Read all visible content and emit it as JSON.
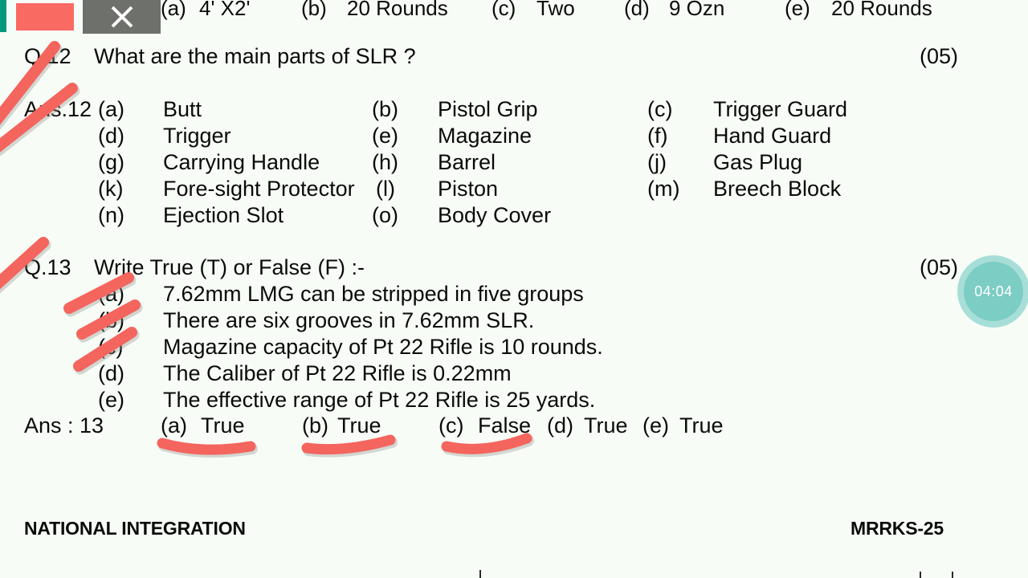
{
  "window": {
    "close_label": "close-icon",
    "accent_teal": "#00997f",
    "accent_red": "#f96a63",
    "close_bg": "#6e706b"
  },
  "timer": {
    "value": "04:04",
    "ring_color": "#a8ded8",
    "fill_color": "#7ccdc4"
  },
  "document": {
    "background": "#f7fdf6",
    "top_row": {
      "items": [
        {
          "label": "(a)",
          "text": "4' X2'"
        },
        {
          "label": "(b)",
          "text": "20 Rounds"
        },
        {
          "label": "(c)",
          "text": "Two"
        },
        {
          "label": "(d)",
          "text": "9 Ozn"
        },
        {
          "label": "(e)",
          "text": "20 Rounds"
        }
      ]
    },
    "question_12": {
      "number": "Q.12",
      "text": "What are the main parts of SLR ?",
      "marks": "(05)",
      "answer_prefix": "Ans.12",
      "rows": [
        [
          {
            "label": "(a)",
            "text": "Butt"
          },
          {
            "label": "(b)",
            "text": "Pistol Grip"
          },
          {
            "label": "(c)",
            "text": "Trigger Guard"
          }
        ],
        [
          {
            "label": "(d)",
            "text": "Trigger"
          },
          {
            "label": "(e)",
            "text": "Magazine"
          },
          {
            "label": "(f)",
            "text": "Hand Guard"
          }
        ],
        [
          {
            "label": "(g)",
            "text": "Carrying Handle"
          },
          {
            "label": "(h)",
            "text": "Barrel"
          },
          {
            "label": "(j)",
            "text": "Gas Plug"
          }
        ],
        [
          {
            "label": "(k)",
            "text": "Fore-sight Protector"
          },
          {
            "label": "(l)",
            "text": "Piston"
          },
          {
            "label": "(m)",
            "text": "Breech Block"
          }
        ],
        [
          {
            "label": "(n)",
            "text": "Ejection Slot"
          },
          {
            "label": "(o)",
            "text": "Body Cover"
          },
          {
            "label": "",
            "text": ""
          }
        ]
      ]
    },
    "question_13": {
      "number": "Q.13",
      "text": "Write True (T) or False (F) :-",
      "marks": "(05)",
      "statements": [
        {
          "label": "(a)",
          "text": "7.62mm LMG can be stripped in five groups"
        },
        {
          "label": "(b)",
          "text": "There are six grooves in 7.62mm SLR."
        },
        {
          "label": "(c)",
          "text": "Magazine capacity of Pt 22 Rifle is 10 rounds."
        },
        {
          "label": "(d)",
          "text": "The Caliber of Pt 22 Rifle is 0.22mm"
        },
        {
          "label": "(e)",
          "text": "The effective range of Pt 22 Rifle is 25 yards."
        }
      ],
      "answer_label": "Ans : 13",
      "answers": [
        {
          "label": "(a)",
          "value": "True"
        },
        {
          "label": "(b)",
          "value": "True"
        },
        {
          "label": "(c)",
          "value": "False"
        },
        {
          "label": "(d)",
          "value": "True"
        },
        {
          "label": "(e)",
          "value": "True"
        }
      ]
    },
    "footer": {
      "left": "NATIONAL INTEGRATION",
      "right": "MRRKS-25"
    }
  },
  "annotations": {
    "marker_color": "#f4655e",
    "marker_shadow": "#8f8f8f"
  }
}
